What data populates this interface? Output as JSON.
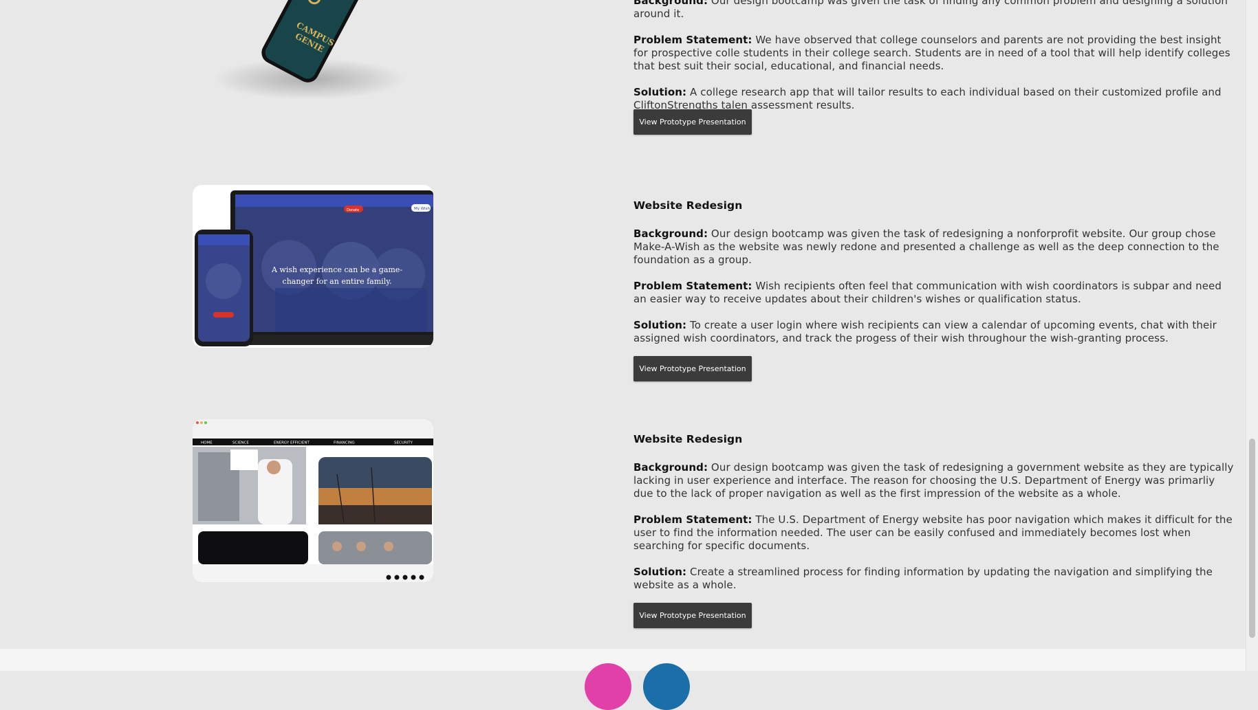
{
  "project1": {
    "background_label": "Background:",
    "background_text": " Our design bootcamp was given the task of finding any common problem and designing a solution around it.",
    "problem_label": "Problem Statement:",
    "problem_text": " We have observed that college counselors and parents are not providing the best insight for prospective colle students in their college search. Students are in need of a tool that will help identify colleges that best suit their social, educational, and financial needs.",
    "solution_label": "Solution:",
    "solution_text": " A college research app that will tailor results to each individual based on their customized profile and CliftonStrengths talen assessment results.",
    "button_label": "View Prototype Presentation",
    "phone_logo_line1": "CAMPUS",
    "phone_logo_line2": "GENIE"
  },
  "project2": {
    "title": "Website Redesign",
    "background_label": "Background:",
    "background_text": " Our design bootcamp was given the task of redesigning a nonforprofit website. Our group chose Make-A-Wish as the website was newly redone and presented a challenge as well as the deep connection to the foundation as a group.",
    "problem_label": "Problem Statement:",
    "problem_text": " Wish recipients often feel that communication with wish coordinators is subpar and need an easier way to receive updates about their children's wishes or qualification status.",
    "solution_label": "Solution:",
    "solution_text": " To create a user login where wish recipients can view a calendar of upcoming events, chat with their assigned wish coordinators, and track the progess of their wish throughour the wish-granting process.",
    "button_label": "View Prototype Presentation",
    "mockup_headline": "A wish experience can be a game-changer for an entire family.",
    "mockup_donate": "Donate",
    "mockup_mywish": "My Wish"
  },
  "project3": {
    "title": "Website Redesign",
    "background_label": "Background:",
    "background_text": " Our design bootcamp was given the task of redesigning a government website as they are typically lacking in user experience and interface. The reason for choosing the U.S. Department of Energy was primarliy due to the lack of proper navigation as well as the first impression of the website as a whole.",
    "problem_label": "Problem Statement:",
    "problem_text": " The U.S. Department of Energy website has poor navigation which makes it difficult for the user to find the information needed. The user can be easily confused and immediately becomes lost when searching for specific documents.",
    "solution_label": "Solution:",
    "solution_text": " Create a streamlined process for finding information by updating the navigation and simplifying the website as a whole.",
    "button_label": "View Prototype Presentation",
    "nav_items": [
      "HOME",
      "SCIENCE",
      "ENERGY EFFICIENT",
      "FINANCING",
      "SECURITY"
    ]
  },
  "colors": {
    "page_bg": "#e8e8e8",
    "button_bg": "#3b3b3b",
    "footer_circle_pink": "#e040a8",
    "footer_circle_blue": "#1a6fa8"
  }
}
